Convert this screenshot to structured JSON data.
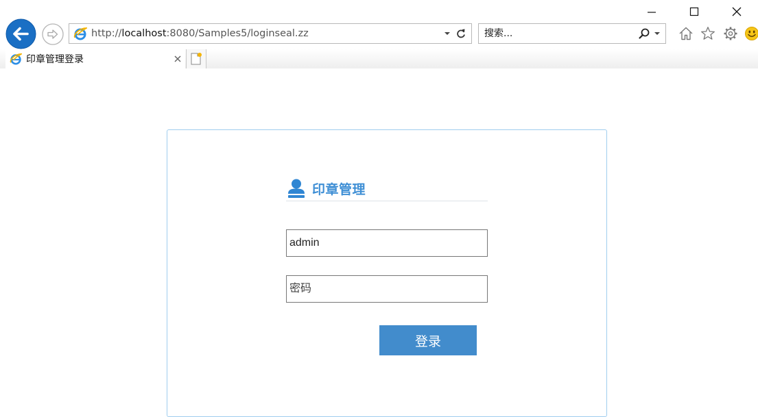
{
  "browser": {
    "address": {
      "scheme": "http://",
      "host": "localhost",
      "rest": ":8080/Samples5/loginseal.zz"
    },
    "search": {
      "placeholder": "搜索..."
    },
    "tabs": [
      {
        "title": "印章管理登录",
        "active": true
      }
    ],
    "icons": [
      "back-icon",
      "forward-icon",
      "ie-logo-icon",
      "dropdown-icon",
      "refresh-icon",
      "search-icon",
      "home-icon",
      "favorites-star-icon",
      "settings-gear-icon",
      "smiley-feedback-icon",
      "close-tab-icon",
      "new-tab-icon",
      "minimize-icon",
      "maximize-icon",
      "close-window-icon"
    ],
    "accent_color": "#1a6fc4"
  },
  "login": {
    "title": "印章管理",
    "username_value": "admin",
    "password_placeholder": "密码",
    "submit_label": "登录",
    "title_color": "#3f8fd5",
    "button_color": "#428ccc",
    "card_border_color": "#9fcdee"
  }
}
